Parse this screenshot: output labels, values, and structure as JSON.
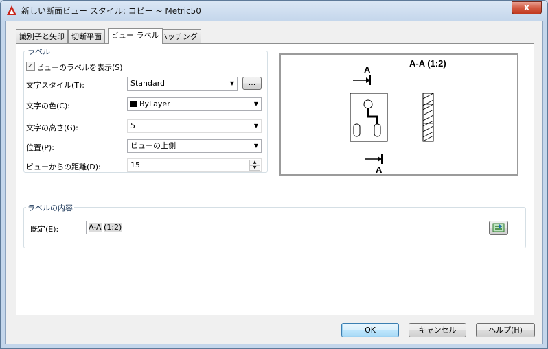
{
  "window": {
    "title": "新しい断面ビュー スタイル: コピー ~ Metric50",
    "close_glyph": "x"
  },
  "tabs": [
    {
      "label": "識別子と矢印"
    },
    {
      "label": "切断平面"
    },
    {
      "label": "ビュー ラベル",
      "active": true
    },
    {
      "label": "ハッチング"
    }
  ],
  "label_group": {
    "title": "ラベル",
    "show_label": {
      "label": "ビューのラベルを表示(S)",
      "checked": true
    },
    "text_style": {
      "label": "文字スタイル(T):",
      "value": "Standard",
      "browse_label": "..."
    },
    "text_color": {
      "label": "文字の色(C):",
      "value": "ByLayer"
    },
    "text_height": {
      "label": "文字の高さ(G):",
      "value": "5"
    },
    "position": {
      "label": "位置(P):",
      "value": "ビューの上側"
    },
    "distance": {
      "label": "ビューからの距離(D):",
      "value": "15"
    }
  },
  "preview": {
    "view_label": "A-A (1:2)",
    "marker_top": "A",
    "marker_bottom": "A"
  },
  "content_group": {
    "title": "ラベルの内容",
    "default_label": "既定(E):",
    "value_part1": "A-A",
    "value_part2": "(1:2)"
  },
  "footer": {
    "ok_label": "OK",
    "cancel_label": "キャンセル",
    "help_label": "ヘルプ(H)"
  },
  "colors": {
    "close_button": "#c0391f",
    "preview_border": "#9b9b9b",
    "title_bar": "#c4d6eb"
  }
}
